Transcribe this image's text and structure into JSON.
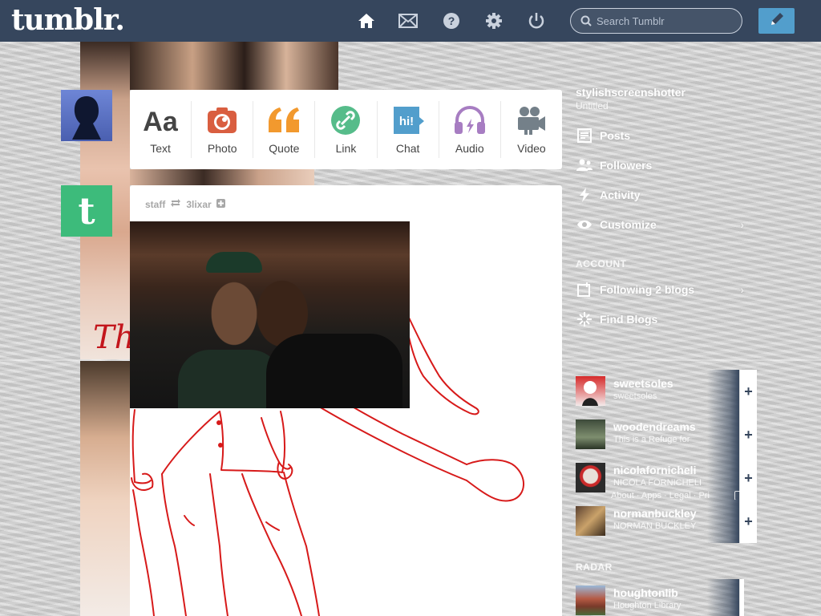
{
  "topbar": {
    "logo": "tumblr.",
    "nav": [
      {
        "name": "home-icon"
      },
      {
        "name": "mail-icon"
      },
      {
        "name": "help-icon"
      },
      {
        "name": "gear-icon"
      },
      {
        "name": "power-icon"
      }
    ],
    "search_placeholder": "Search Tumblr",
    "compose_icon": "pencil-icon"
  },
  "colors": {
    "topbar": "#36465d",
    "compose": "#529ecc",
    "text_type": "#444444",
    "photo_type": "#d95e40",
    "quote_type": "#f2992e",
    "link_type": "#56bc8a",
    "chat_type": "#529ecc",
    "audio_type": "#a77dc2",
    "video_type": "#748089",
    "staff_avatar": "#3dbb7b"
  },
  "post_types": [
    {
      "label": "Text",
      "icon": "text-icon"
    },
    {
      "label": "Photo",
      "icon": "camera-icon"
    },
    {
      "label": "Quote",
      "icon": "quote-icon"
    },
    {
      "label": "Link",
      "icon": "link-icon"
    },
    {
      "label": "Chat",
      "icon": "chat-icon",
      "glyph": "hi!"
    },
    {
      "label": "Audio",
      "icon": "headphones-icon"
    },
    {
      "label": "Video",
      "icon": "video-camera-icon"
    }
  ],
  "post": {
    "author": "staff",
    "reblogged_from": "3lixar",
    "staff_avatar_letter": "t"
  },
  "background": {
    "red_text": "Th"
  },
  "sidebar": {
    "blog_name": "stylishscreenshotter",
    "blog_sub": "Untitled",
    "items": [
      {
        "label": "Posts",
        "icon": "posts-icon"
      },
      {
        "label": "Followers",
        "icon": "followers-icon"
      },
      {
        "label": "Activity",
        "icon": "activity-icon"
      },
      {
        "label": "Customize",
        "icon": "eye-icon"
      }
    ],
    "account_heading": "ACCOUNT",
    "account_items": [
      {
        "label": "Following 2 blogs",
        "icon": "following-icon"
      },
      {
        "label": "Find Blogs",
        "icon": "find-blogs-icon"
      }
    ],
    "recommended": [
      {
        "name": "sweetsoles",
        "desc": "sweetsoles"
      },
      {
        "name": "woodendreams",
        "desc": "This is a Refuge for"
      },
      {
        "name": "nicolafornicheli",
        "desc": "NICOLA FORNICHELI"
      },
      {
        "name": "normanbuckley",
        "desc": "NORMAN BUCKLEY"
      }
    ],
    "footer_links": "About · Apps · Legal · Pri",
    "radar_heading": "RADAR",
    "radar": {
      "name": "houghtonlib",
      "desc": "Houghton Library"
    }
  }
}
